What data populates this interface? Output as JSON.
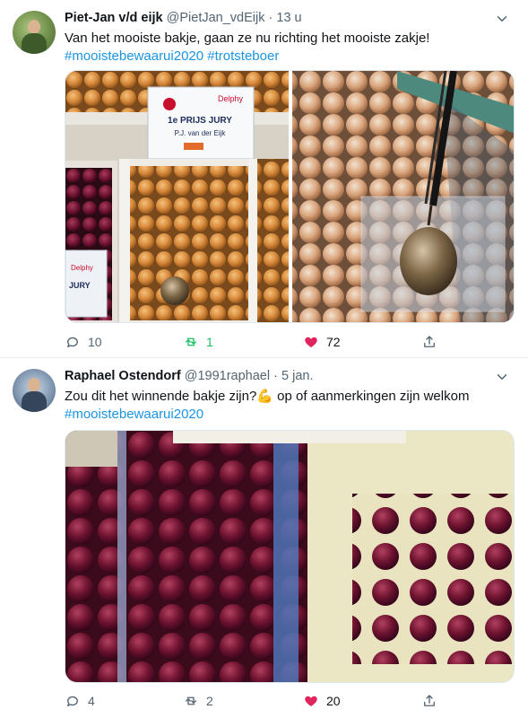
{
  "tweets": [
    {
      "name": "Piet-Jan v/d eijk",
      "handle": "@PietJan_vdEijk",
      "sep": "·",
      "time": "13 u",
      "text": "Van het mooiste bakje, gaan ze nu richting het mooiste zakje!",
      "hashtags": [
        "#mooistebewaarui2020",
        "#trotsteboer"
      ],
      "media_text": {
        "sign_title": "1e PRIJS JURY",
        "sign_name": "P.J. van der Eijk",
        "sign_brand": "Delphy",
        "sign_small": "Delphy",
        "sign_jury": "JURY"
      },
      "replies": "10",
      "retweets": "1",
      "likes": "72",
      "retweet_color": "#17bf63",
      "like_color": "#e0245e"
    },
    {
      "name": "Raphael Ostendorf",
      "handle": "@1991raphael",
      "sep": "·",
      "time": "5 jan.",
      "text_before": "Zou dit het winnende bakje zijn?",
      "emoji": "💪",
      "text_after": " op of aanmerkingen zijn welkom",
      "hashtags": [
        "#mooistebewaarui2020"
      ],
      "replies": "4",
      "retweets": "2",
      "likes": "20",
      "like_color": "#e0245e"
    }
  ],
  "icons": [
    "chevron-down-icon",
    "reply-icon",
    "retweet-icon",
    "heart-icon",
    "share-icon"
  ]
}
